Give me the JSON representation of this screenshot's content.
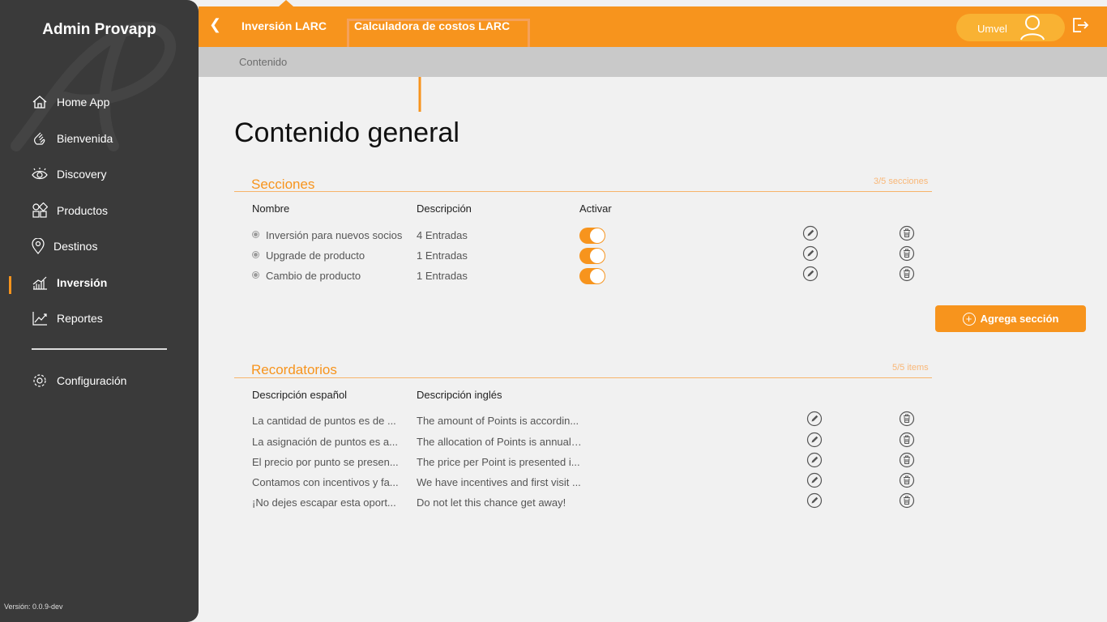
{
  "app": {
    "title": "Admin Provapp",
    "version": "Versión: 0.0.9-dev"
  },
  "sidebar": {
    "items": [
      {
        "label": "Home App",
        "icon": "home-icon"
      },
      {
        "label": "Bienvenida",
        "icon": "wave-hand-icon"
      },
      {
        "label": "Discovery",
        "icon": "eye-icon"
      },
      {
        "label": "Productos",
        "icon": "shapes-icon"
      },
      {
        "label": "Destinos",
        "icon": "location-pin-icon"
      },
      {
        "label": "Inversión",
        "icon": "bar-chart-icon",
        "active": true
      },
      {
        "label": "Reportes",
        "icon": "line-chart-icon"
      },
      {
        "label": "Configuración",
        "icon": "gear-icon"
      }
    ]
  },
  "header": {
    "crumb_1": "Inversión LARC",
    "crumb_2": "Calculadora de costos LARC",
    "user_name": "Umvel",
    "accent_color": "#f7941d"
  },
  "subheader": {
    "label": "Contenido"
  },
  "main": {
    "title": "Contenido general",
    "sections": {
      "title": "Secciones",
      "count": "3/5 secciones",
      "columns": {
        "name": "Nombre",
        "description": "Descripción",
        "activate": "Activar"
      },
      "rows": [
        {
          "name": "Inversión para nuevos socios",
          "description": "4 Entradas",
          "active": true
        },
        {
          "name": "Upgrade de producto",
          "description": "1 Entradas",
          "active": true
        },
        {
          "name": "Cambio de producto",
          "description": "1 Entradas",
          "active": true
        }
      ],
      "add_label": "Agrega sección"
    },
    "reminders": {
      "title": "Recordatorios",
      "count": "5/5 items",
      "columns": {
        "es": "Descripción español",
        "en": "Descripción inglés"
      },
      "rows": [
        {
          "es": "La cantidad de puntos es de ...",
          "en": "The amount of Points is accordin..."
        },
        {
          "es": "La asignación de puntos es a...",
          "en": "The allocation of Points is annual ..."
        },
        {
          "es": "El precio por punto se presen...",
          "en": "The price per Point is presented i..."
        },
        {
          "es": "Contamos con incentivos y fa...",
          "en": "We have incentives and first visit ..."
        },
        {
          "es": "¡No dejes escapar esta oport...",
          "en": "Do not let this chance get away!"
        }
      ]
    }
  }
}
